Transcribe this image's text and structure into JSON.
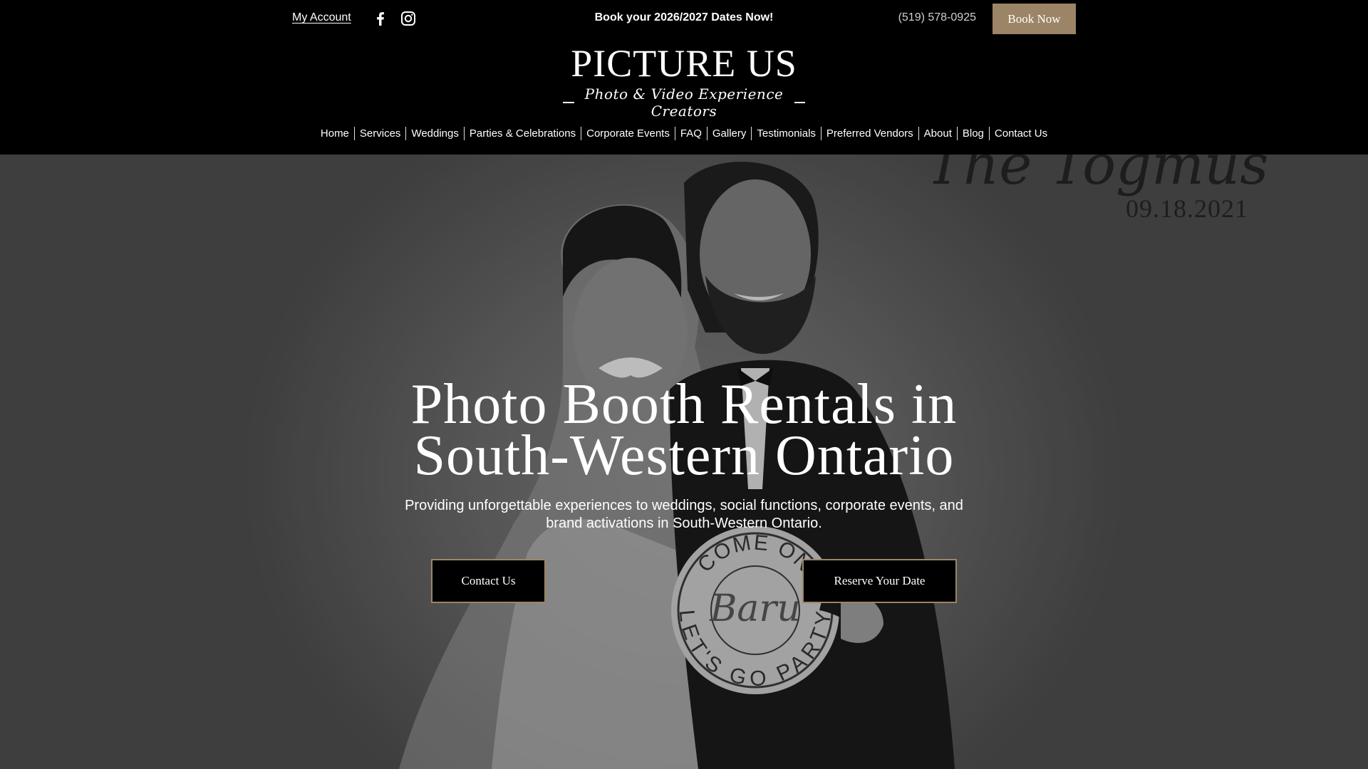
{
  "topbar": {
    "account_label": "My Account",
    "promo": "Book your 2026/2027 Dates Now!",
    "phone": "(519) 578-0925",
    "book_button": "Book Now",
    "social_icons": [
      "facebook-icon",
      "instagram-icon"
    ]
  },
  "logo": {
    "title": "PICTURE US",
    "tagline": "Photo & Video Experience Creators"
  },
  "nav": {
    "items": [
      {
        "label": "Home"
      },
      {
        "label": "Services"
      },
      {
        "label": "Weddings"
      },
      {
        "label": "Parties & Celebrations"
      },
      {
        "label": "Corporate Events"
      },
      {
        "label": "FAQ"
      },
      {
        "label": "Gallery"
      },
      {
        "label": "Testimonials"
      },
      {
        "label": "Preferred Vendors"
      },
      {
        "label": "About"
      },
      {
        "label": "Blog"
      },
      {
        "label": "Contact Us"
      }
    ]
  },
  "hero": {
    "title": "Photo Booth Rentals in South-Western Ontario",
    "subtitle": "Providing unforgettable experiences to weddings, social functions, corporate events, and brand activations in South-Western Ontario.",
    "contact_button": "Contact Us",
    "reserve_button": "Reserve Your Date",
    "backdrop_sign": {
      "name": "The Togmus",
      "date": "09.18.2021"
    },
    "prop_sign": {
      "top": "COME ON",
      "middle": "Baru",
      "bottom": "LET'S GO PARTY"
    }
  },
  "colors": {
    "header_bg": "#000000",
    "accent": "#9c8566",
    "text": "#ffffff"
  }
}
